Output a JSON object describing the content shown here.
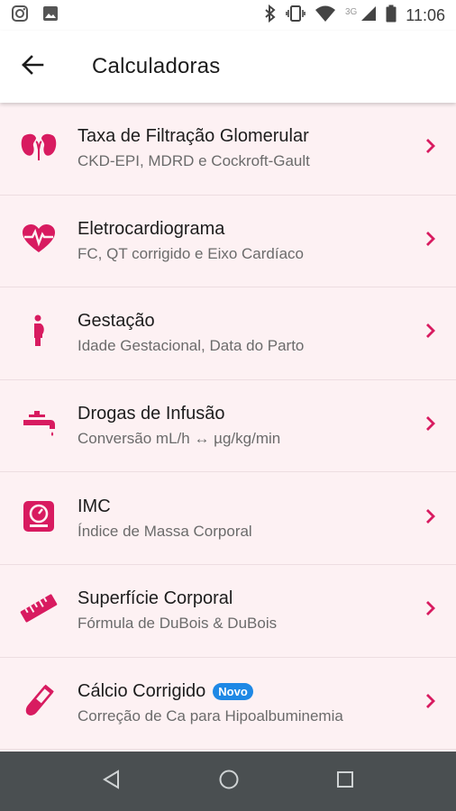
{
  "status_bar": {
    "time": "11:06",
    "network": "3G"
  },
  "app_bar": {
    "title": "Calculadoras"
  },
  "accent_color": "#d81b60",
  "items": [
    {
      "title": "Taxa de Filtração Glomerular",
      "subtitle": "CKD-EPI, MDRD e Cockroft-Gault",
      "icon": "kidneys-icon"
    },
    {
      "title": "Eletrocardiograma",
      "subtitle": "FC, QT corrigido e Eixo Cardíaco",
      "icon": "heartbeat-icon"
    },
    {
      "title": "Gestação",
      "subtitle": "Idade Gestacional, Data do Parto",
      "icon": "pregnant-woman-icon"
    },
    {
      "title": "Drogas de Infusão",
      "subtitle": "Conversão mL/h ↔ µg/kg/min",
      "icon": "faucet-icon"
    },
    {
      "title": "IMC",
      "subtitle": "Índice de Massa Corporal",
      "icon": "scale-icon"
    },
    {
      "title": "Superfície Corporal",
      "subtitle": "Fórmula de DuBois & DuBois",
      "icon": "ruler-icon"
    },
    {
      "title": "Cálcio Corrigido",
      "subtitle": "Correção de Ca para Hipoalbuminemia",
      "icon": "test-tube-icon",
      "badge": "Novo"
    }
  ]
}
